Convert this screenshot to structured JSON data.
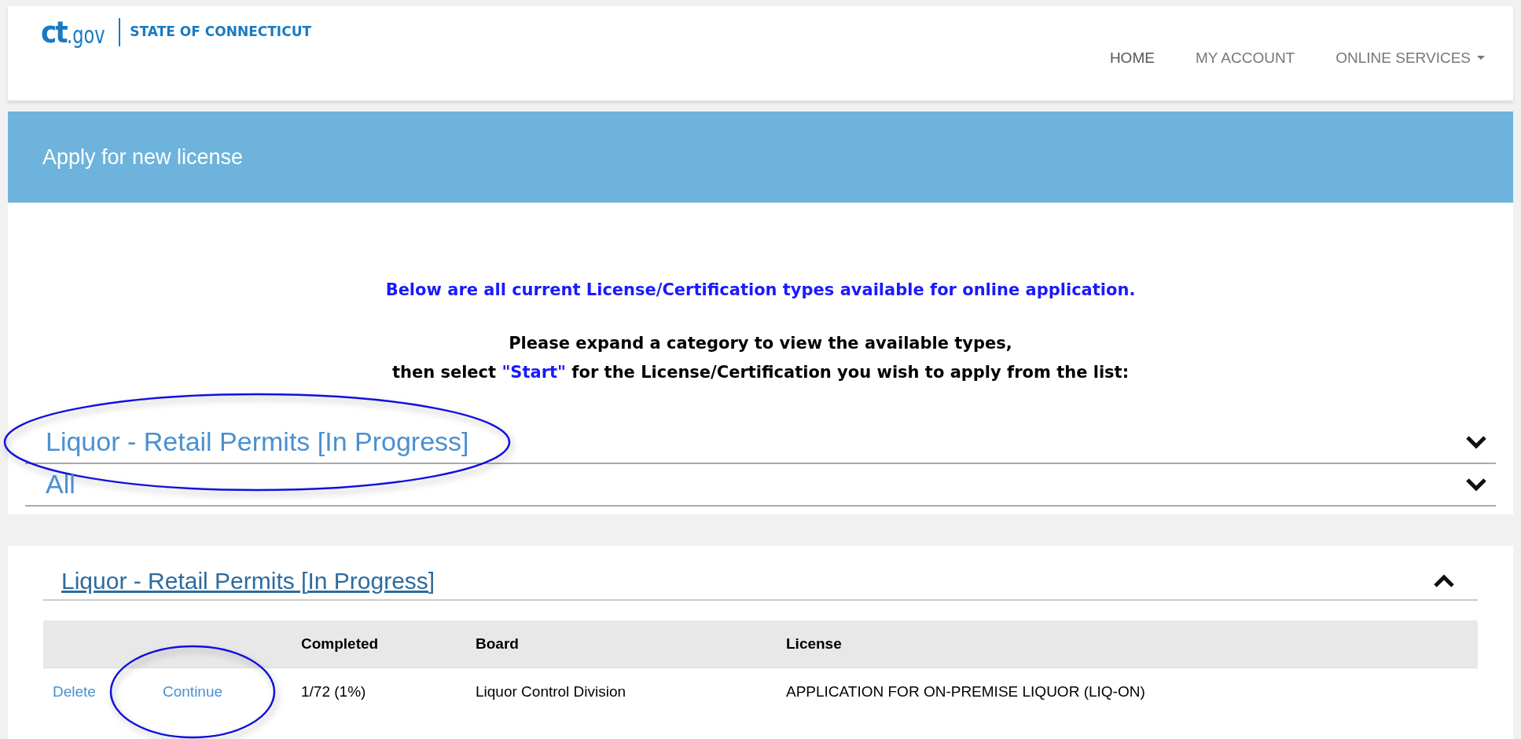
{
  "header": {
    "logo_text": "ct",
    "logo_suffix": ".gov",
    "site_name": "STATE OF CONNECTICUT",
    "nav": [
      {
        "label": "HOME",
        "selected": true,
        "dropdown": false
      },
      {
        "label": "MY ACCOUNT",
        "selected": false,
        "dropdown": false
      },
      {
        "label": "ONLINE SERVICES",
        "selected": false,
        "dropdown": true
      }
    ]
  },
  "banner": {
    "title": "Apply for new license"
  },
  "intro": {
    "headline": "Below are all current License/Certification types available for online application.",
    "instruction_line_1": "Please expand a category to view the available types,",
    "instruction_line_2": [
      {
        "text": "then select ",
        "emphasis": false
      },
      {
        "text": "\"Start\"",
        "emphasis": true
      },
      {
        "text": " for the License/Certification you wish to apply from the list:",
        "emphasis": false
      }
    ]
  },
  "categories": [
    {
      "label": "Liquor - Retail Permits [In Progress]",
      "expanded": false,
      "highlighted": true
    },
    {
      "label": "All",
      "expanded": false,
      "highlighted": false
    }
  ],
  "panel": {
    "title": "Liquor - Retail Permits [In Progress]",
    "expanded": true,
    "table": {
      "columns": [
        "Completed",
        "Board",
        "License"
      ],
      "rows": [
        {
          "actions": [
            {
              "label": "Delete",
              "highlighted": false
            },
            {
              "label": "Continue",
              "highlighted": true
            }
          ],
          "completed": "1/72 (1%)",
          "board": "Liquor Control Division",
          "license": "APPLICATION FOR ON-PREMISE LIQUOR (LIQ-ON)"
        }
      ]
    }
  }
}
